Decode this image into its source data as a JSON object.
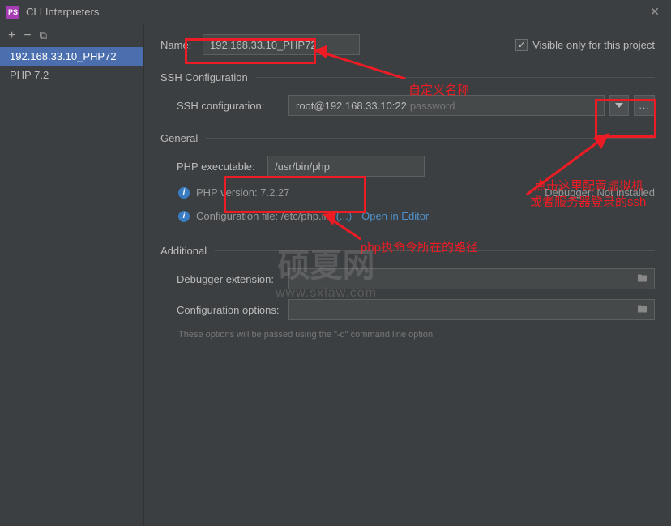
{
  "window": {
    "title": "CLI Interpreters",
    "icon_label": "PS"
  },
  "sidebar": {
    "items": [
      {
        "label": "192.168.33.10_PHP72"
      },
      {
        "label": "PHP 7.2"
      }
    ]
  },
  "form": {
    "name_label": "Name:",
    "name_value": "192.168.33.10_PHP72",
    "visible_only_label": "Visible only for this project",
    "ssh_section": "SSH Configuration",
    "ssh_label": "SSH configuration:",
    "ssh_value": "root@192.168.33.10:22",
    "ssh_password_hint": "password",
    "general_section": "General",
    "php_exe_label": "PHP executable:",
    "php_exe_value": "/usr/bin/php",
    "php_version_label": "PHP version: 7.2.27",
    "debugger_label": "Debugger: Not installed",
    "config_file_label": "Configuration file: /etc/php.ini",
    "config_ellipsis": "(...)",
    "open_in_editor": "Open in Editor",
    "additional_section": "Additional",
    "debugger_ext_label": "Debugger extension:",
    "config_options_label": "Configuration options:",
    "hint": "These options will be passed using the \"-d\" command line option"
  },
  "annotations": {
    "custom_name": "自定义名称",
    "php_path": "php执命令所在的路径",
    "ssh_config_1": "点击这里配置虚拟机",
    "ssh_config_2": "或者服务器登录的ssh"
  },
  "watermark": {
    "main": "硕夏网",
    "sub": "www.sxiaw.com"
  }
}
